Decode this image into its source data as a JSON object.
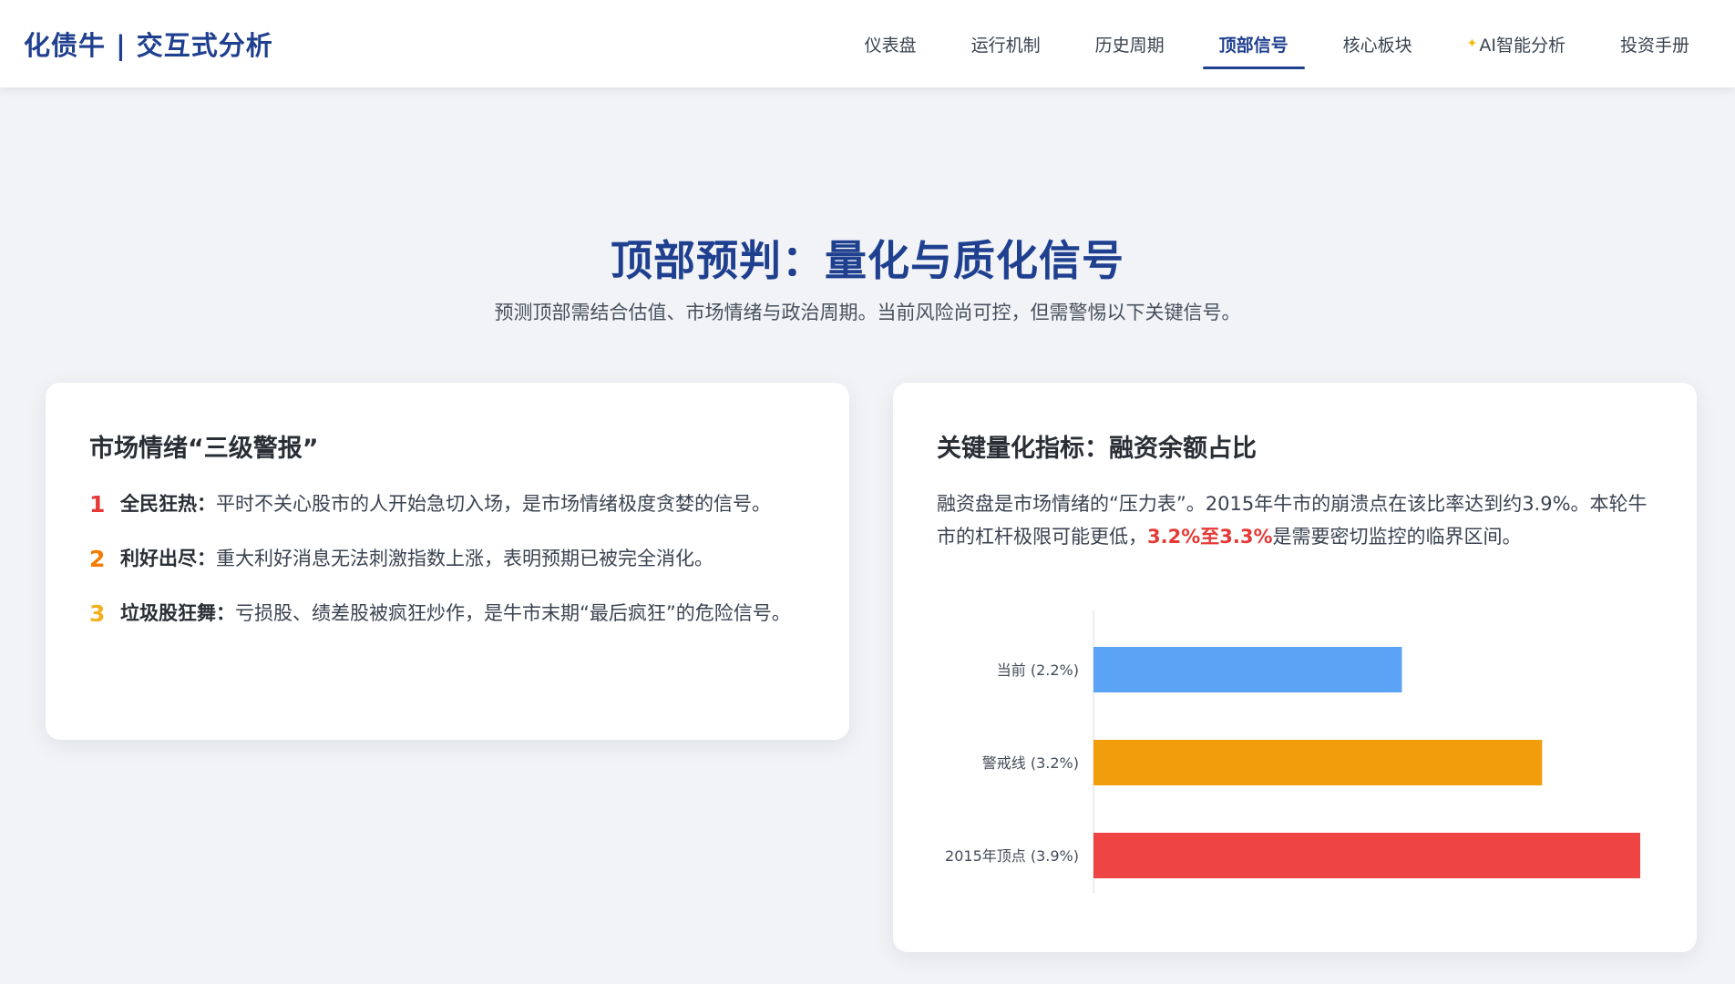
{
  "brand": "化债牛 | 交互式分析",
  "nav": [
    {
      "label": "仪表盘",
      "active": false,
      "icon": ""
    },
    {
      "label": "运行机制",
      "active": false,
      "icon": ""
    },
    {
      "label": "历史周期",
      "active": false,
      "icon": ""
    },
    {
      "label": "顶部信号",
      "active": true,
      "icon": ""
    },
    {
      "label": "核心板块",
      "active": false,
      "icon": ""
    },
    {
      "label": "AI智能分析",
      "active": false,
      "icon": "sparkle-icon"
    },
    {
      "label": "投资手册",
      "active": false,
      "icon": ""
    }
  ],
  "hero": {
    "title": "顶部预判：量化与质化信号",
    "subtitle": "预测顶部需结合估值、市场情绪与政治周期。当前风险尚可控，但需警惕以下关键信号。"
  },
  "left_card": {
    "title": "市场情绪“三级警报”",
    "items": [
      {
        "num": "1",
        "heading": "全民狂热：",
        "text": "平时不关心股市的人开始急切入场，是市场情绪极度贪婪的信号。",
        "color": "#e53935"
      },
      {
        "num": "2",
        "heading": "利好出尽：",
        "text": "重大利好消息无法刺激指数上涨，表明预期已被完全消化。",
        "color": "#f57c00"
      },
      {
        "num": "3",
        "heading": "垃圾股狂舞：",
        "text": "亏损股、绩差股被疯狂炒作，是牛市末期“最后疯狂”的危险信号。",
        "color": "#f2b01e"
      }
    ]
  },
  "right_card": {
    "title": "关键量化指标：融资余额占比",
    "desc_before": "融资盘是市场情绪的“压力表”。2015年牛市的崩溃点在该比率达到约3.9%。本轮牛市的杠杆极限可能更低，",
    "desc_highlight": "3.2%至3.3%",
    "desc_after": "是需要密切监控的临界区间。"
  },
  "chart_data": {
    "type": "bar",
    "orientation": "horizontal",
    "categories": [
      "当前 (2.2%)",
      "警戒线 (3.2%)",
      "2015年顶点 (3.9%)"
    ],
    "values": [
      2.2,
      3.2,
      3.9
    ],
    "colors": [
      "#5ba3f5",
      "#f29e0c",
      "#ee4444"
    ],
    "xlim": [
      0,
      3.9
    ],
    "grid": false,
    "legend": "none"
  }
}
